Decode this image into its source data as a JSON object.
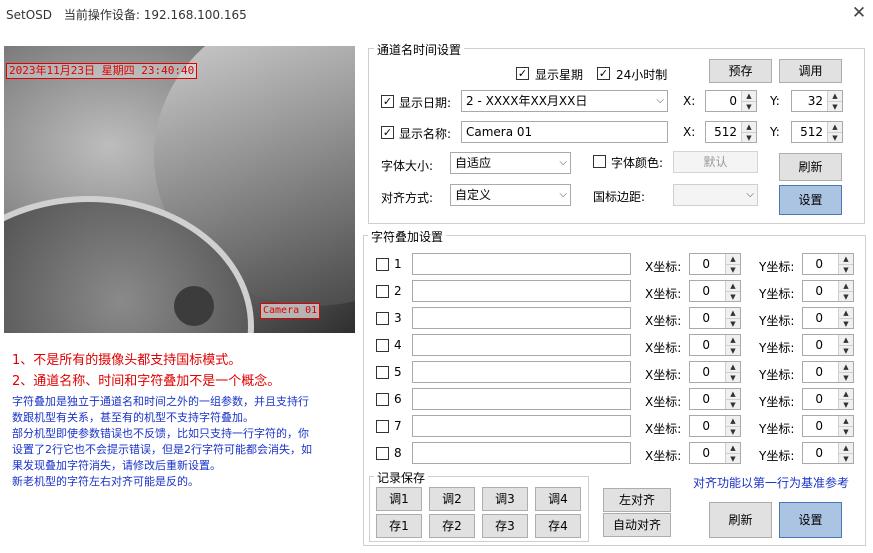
{
  "window": {
    "title": "SetOSD",
    "device_prefix": "当前操作设备:",
    "device_ip": "192.168.100.165",
    "close_glyph": "✕"
  },
  "preview": {
    "osd_datetime": "2023年11月23日 星期四 23:40:40",
    "osd_name": "Camera 01"
  },
  "notes": {
    "red": [
      "1、不是所有的摄像头都支持国标模式。",
      "2、通道名称、时间和字符叠加不是一个概念。"
    ],
    "blue": [
      "字符叠加是独立于通道名和时间之外的一组参数，并且支持行",
      "数跟机型有关系，甚至有的机型不支持字符叠加。",
      "部分机型即使参数错误也不反馈，比如只支持一行字符的，你",
      "设置了2行它也不会提示错误，但是2行字符可能都会消失，如",
      "果发现叠加字符消失，请修改后重新设置。",
      "新老机型的字符左右对齐可能是反的。"
    ]
  },
  "channel": {
    "group_title": "通道名时间设置",
    "show_week_label": "显示星期",
    "show_week_checked": true,
    "hour24_label": "24小时制",
    "hour24_checked": true,
    "preset_button": "预存",
    "recall_button": "调用",
    "show_date_label": "显示日期:",
    "show_date_checked": true,
    "date_format": "2 - XXXX年XX月XX日",
    "date_x_label": "X:",
    "date_x": "0",
    "date_y_label": "Y:",
    "date_y": "32",
    "show_name_label": "显示名称:",
    "show_name_checked": true,
    "name_value": "Camera 01",
    "name_x_label": "X:",
    "name_x": "512",
    "name_y_label": "Y:",
    "name_y": "512",
    "font_size_label": "字体大小:",
    "font_size_value": "自适应",
    "font_color_label": "字体颜色:",
    "font_color_checked": false,
    "font_color_value": "默认",
    "refresh_button": "刷新",
    "align_label": "对齐方式:",
    "align_value": "自定义",
    "gb_margin_label": "国标边距:",
    "gb_margin_value": "",
    "set_button": "设置"
  },
  "overlay": {
    "group_title": "字符叠加设置",
    "x_label": "X坐标:",
    "y_label": "Y坐标:",
    "rows": [
      {
        "num": "1",
        "checked": false,
        "text": "",
        "x": "0",
        "y": "0"
      },
      {
        "num": "2",
        "checked": false,
        "text": "",
        "x": "0",
        "y": "0"
      },
      {
        "num": "3",
        "checked": false,
        "text": "",
        "x": "0",
        "y": "0"
      },
      {
        "num": "4",
        "checked": false,
        "text": "",
        "x": "0",
        "y": "0"
      },
      {
        "num": "5",
        "checked": false,
        "text": "",
        "x": "0",
        "y": "0"
      },
      {
        "num": "6",
        "checked": false,
        "text": "",
        "x": "0",
        "y": "0"
      },
      {
        "num": "7",
        "checked": false,
        "text": "",
        "x": "0",
        "y": "0"
      },
      {
        "num": "8",
        "checked": false,
        "text": "",
        "x": "0",
        "y": "0"
      }
    ],
    "record_title": "记录保存",
    "recall_buttons": [
      "调1",
      "调2",
      "调3",
      "调4"
    ],
    "save_buttons": [
      "存1",
      "存2",
      "存3",
      "存4"
    ],
    "left_align_button": "左对齐",
    "auto_align_button": "自动对齐",
    "align_hint": "对齐功能以第一行为基准参考",
    "refresh_button": "刷新",
    "set_button": "设置"
  },
  "glyphs": {
    "check": "✓",
    "combo_arrow": "⌵",
    "spin_up": "▲",
    "spin_down": "▼"
  },
  "colors": {
    "osd_red": "#e00000",
    "note_red": "#e00000",
    "note_blue": "#1a33c8",
    "primary_button": "#aac4e2"
  }
}
